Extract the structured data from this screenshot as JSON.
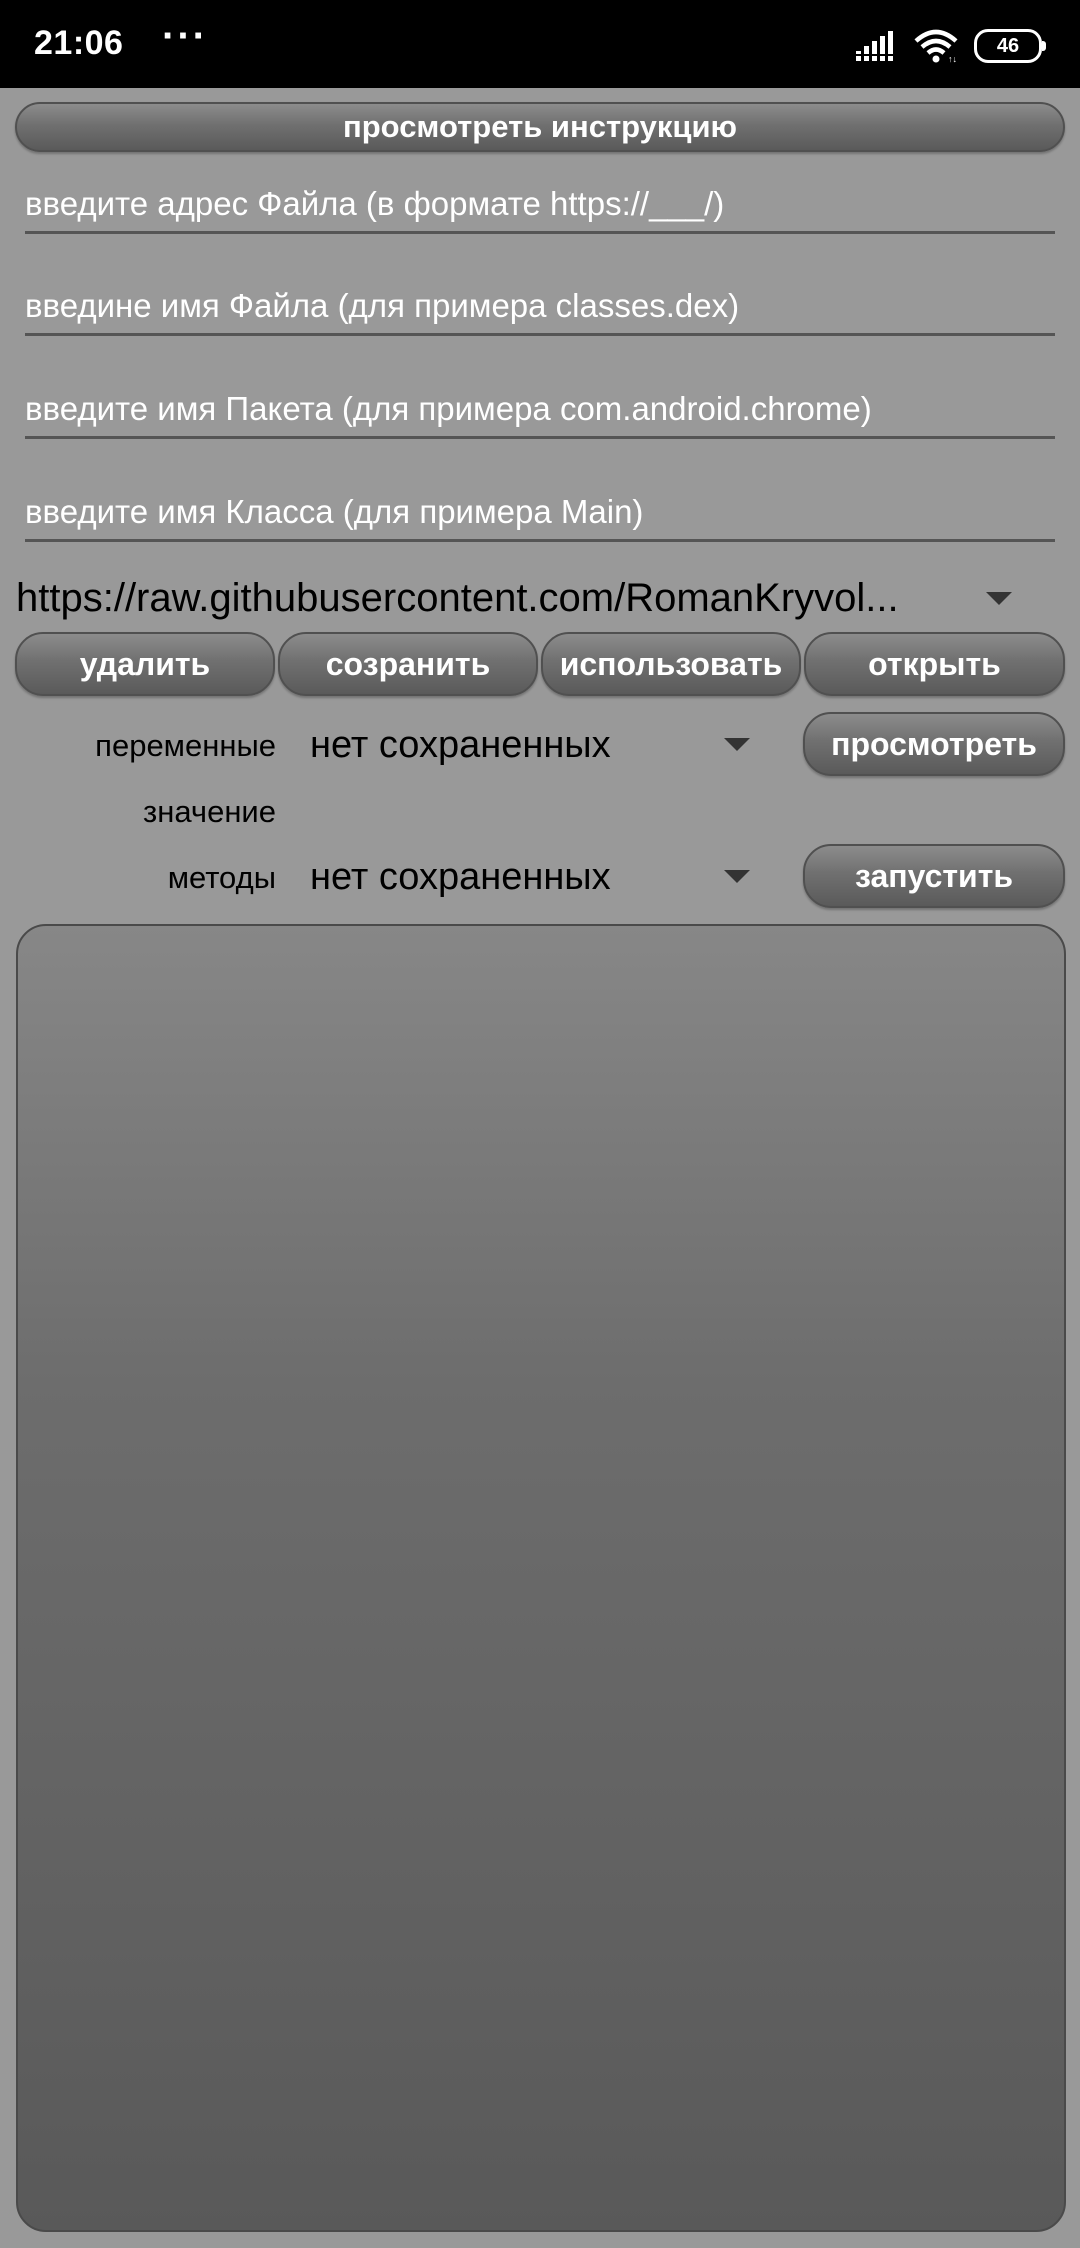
{
  "status_bar": {
    "time": "21:06",
    "dots": "···",
    "battery": "46",
    "icons": [
      "signal-icon",
      "wifi-icon",
      "battery-icon"
    ]
  },
  "instruction_button": "просмотреть инструкцию",
  "fields": {
    "file_url_placeholder": "введите адрес Файла (в формате https://___/)",
    "file_name_placeholder": "введине имя Файла (для примера classes.dex)",
    "package_name_placeholder": "введите имя Пакета (для примера com.android.chrome)",
    "class_name_placeholder": "введите имя Класса (для примера Main)"
  },
  "url_select": {
    "value": "https://raw.githubusercontent.com/RomanKryvol..."
  },
  "actions": {
    "delete": "удалить",
    "save": "созранить",
    "use": "использовать",
    "open": "открыть"
  },
  "variables": {
    "label": "переменные",
    "selected": "нет сохраненных",
    "view_button": "просмотреть"
  },
  "value_label": "значение",
  "methods": {
    "label": "методы",
    "selected": "нет сохраненных",
    "run_button": "запустить"
  },
  "colors": {
    "background": "#999999",
    "status_bar": "#000000",
    "button_top": "#8c8c8c",
    "button_bottom": "#5a5a5a"
  }
}
